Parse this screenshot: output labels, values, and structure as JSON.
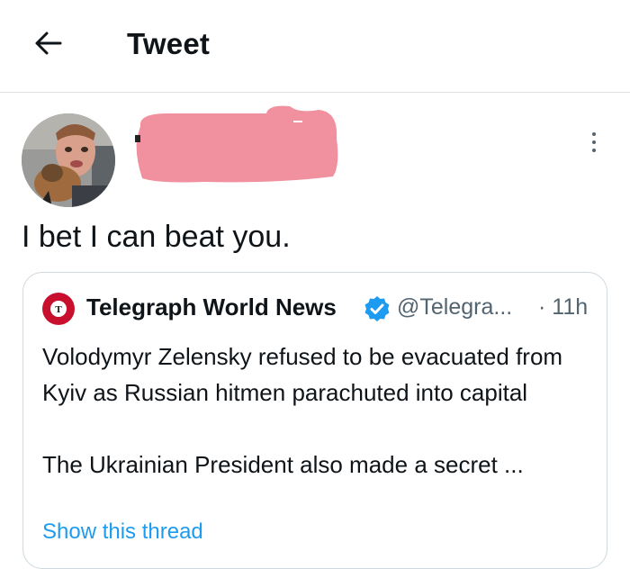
{
  "header": {
    "title": "Tweet",
    "back_icon": "arrow-left-icon"
  },
  "tweet": {
    "text": "I bet I can beat you.",
    "more_icon": "more-vertical-icon"
  },
  "quote": {
    "name": "Telegraph World News",
    "handle": "@Telegra...",
    "time": "· 11h",
    "body_line1": "Volodymyr Zelensky refused to be evacuated from Kyiv as Russian hitmen parachuted into capital",
    "body_line2": "The Ukrainian President also made a secret ...",
    "show_thread": "Show this thread"
  },
  "colors": {
    "accent": "#1d9bf0",
    "redaction": "#f1909e",
    "verified": "#1d9bf0",
    "telegraph_logo": "#c8102e"
  }
}
